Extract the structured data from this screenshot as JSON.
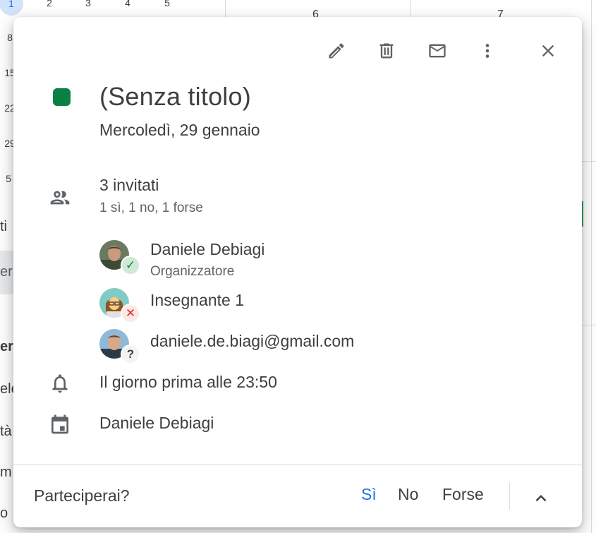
{
  "background": {
    "mini_calendar_days": [
      "1",
      "2",
      "3",
      "4",
      "5"
    ],
    "mini_calendar_week_starts": [
      "8",
      "15",
      "22",
      "29",
      "5"
    ],
    "big_days": [
      "6",
      "7"
    ],
    "side_fragments": [
      "ti",
      "er",
      "er",
      "ele",
      "tà",
      "m",
      "o"
    ]
  },
  "event": {
    "color": "#0b8043",
    "title": "(Senza titolo)",
    "date": "Mercoledì, 29 gennaio"
  },
  "toolbar": {
    "icons": [
      "edit-icon",
      "delete-icon",
      "email-icon",
      "more-vert-icon",
      "close-icon"
    ]
  },
  "guests": {
    "count_label": "3 invitati",
    "summary": "1 sì, 1 no, 1 forse",
    "list": [
      {
        "name": "Daniele Debiagi",
        "role": "Organizzatore",
        "status": "yes",
        "status_symbol": "✓"
      },
      {
        "name": "Insegnante 1",
        "role": "",
        "status": "no",
        "status_symbol": "✕"
      },
      {
        "name": "daniele.de.biagi@gmail.com",
        "role": "",
        "status": "maybe",
        "status_symbol": "?"
      }
    ]
  },
  "reminder": {
    "text": "Il giorno prima alle 23:50"
  },
  "calendar": {
    "owner": "Daniele Debiagi"
  },
  "rsvp": {
    "question": "Parteciperai?",
    "yes_label": "Sì",
    "no_label": "No",
    "maybe_label": "Forse",
    "selected": "yes",
    "accent_color": "#1a73e8"
  }
}
